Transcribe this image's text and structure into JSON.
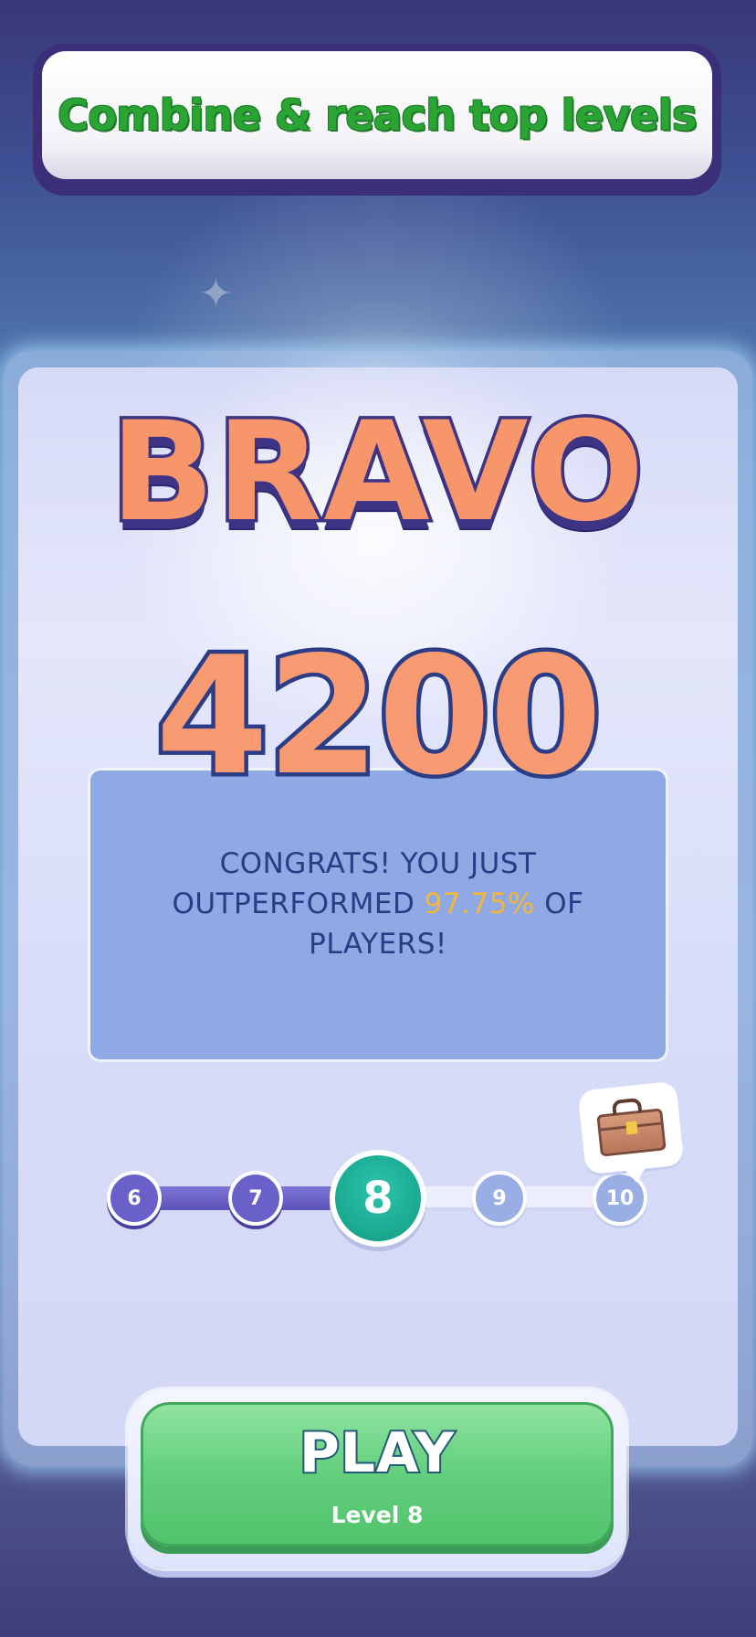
{
  "banner": {
    "title": "Combine & reach top levels"
  },
  "result": {
    "headline": "BRAVO",
    "score": "4200",
    "message_part1": "CONGRATS! YOU JUST OUTPERFORMED ",
    "percentile": "97.75%",
    "message_part2": " OF PLAYERS!"
  },
  "progress": {
    "levels": [
      "6",
      "7",
      "8",
      "9",
      "10"
    ],
    "current_level": "8",
    "reward_icon": "treasure-chest-icon"
  },
  "play_button": {
    "label": "PLAY",
    "sublabel": "Level 8"
  },
  "colors": {
    "accent_green": "#62cf7c",
    "current_level_teal": "#19a98f",
    "percentile_yellow": "#f2b63a",
    "text_navy": "#2b3c86"
  }
}
